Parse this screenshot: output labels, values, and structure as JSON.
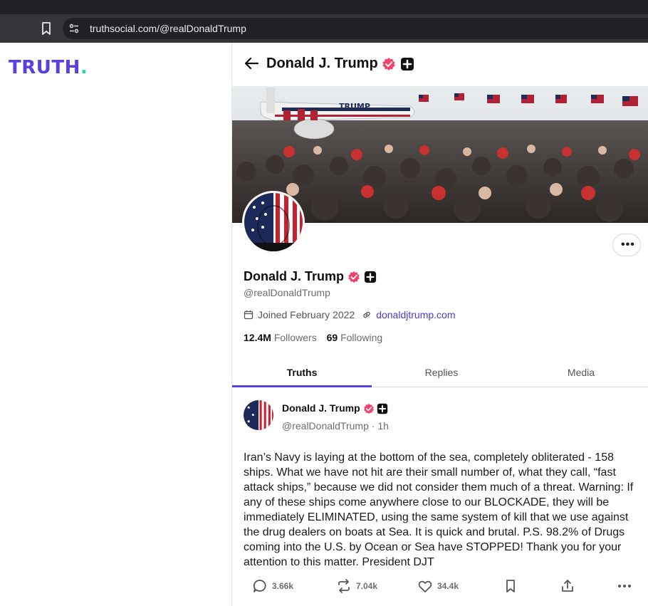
{
  "browser": {
    "url": "truthsocial.com/@realDonaldTrump"
  },
  "sidebar": {
    "logo_text": "TRUTH",
    "logo_dot": "."
  },
  "header": {
    "name": "Donald J. Trump"
  },
  "profile": {
    "name": "Donald J. Trump",
    "handle": "@realDonaldTrump",
    "joined": "Joined February 2022",
    "website": "donaldjtrump.com",
    "followers_count": "12.4M",
    "followers_label": "Followers",
    "following_count": "69",
    "following_label": "Following"
  },
  "tabs": [
    {
      "label": "Truths",
      "active": true
    },
    {
      "label": "Replies",
      "active": false
    },
    {
      "label": "Media",
      "active": false
    }
  ],
  "post": {
    "author": "Donald J. Trump",
    "handle": "@realDonaldTrump",
    "separator": "·",
    "time": "1h",
    "text": "Iran’s Navy is laying at the bottom of the sea, completely obliterated - 158 ships. What we have not hit are their small number of, what they call, “fast attack ships,” because we did not consider them much of a threat. Warning: If any of these ships come anywhere close to our BLOCKADE, they will be immediately ELIMINATED, using the same system of kill that we use against the drug dealers on boats at Sea. It is quick and brutal. P.S. 98.2% of Drugs coming into the U.S. by Ocean or Sea have STOPPED! Thank you for your attention to this matter. President DJT",
    "replies": "3.66k",
    "retruths": "7.04k",
    "likes": "34.4k"
  },
  "colors": {
    "brand": "#5b3fe0",
    "accent_dot": "#2ad3b4",
    "verified": "#f0426b"
  },
  "icons": [
    "bookmark-icon",
    "site-settings-icon",
    "back-arrow-icon",
    "verified-badge-icon",
    "plus-badge-icon",
    "more-icon",
    "calendar-icon",
    "link-icon",
    "reply-icon",
    "retruth-icon",
    "like-icon",
    "save-icon",
    "share-icon"
  ]
}
